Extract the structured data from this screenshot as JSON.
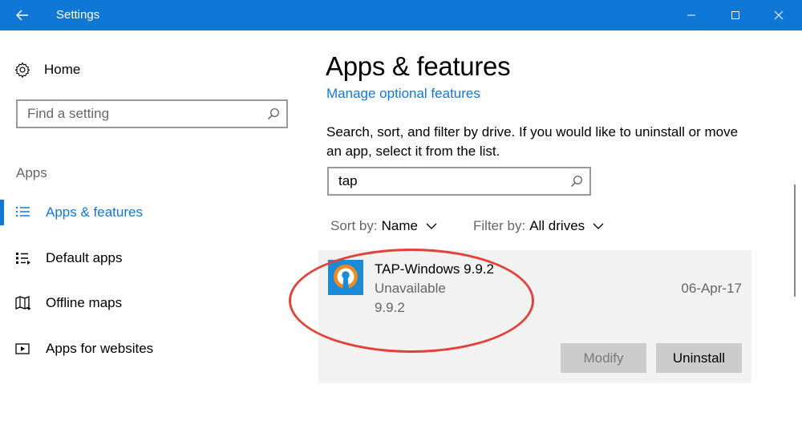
{
  "window": {
    "title": "Settings",
    "accent": "#0f78d7"
  },
  "sidebar": {
    "home_label": "Home",
    "search_placeholder": "Find a setting",
    "section_label": "Apps",
    "items": [
      {
        "label": "Apps & features",
        "icon": "list-icon",
        "active": true
      },
      {
        "label": "Default apps",
        "icon": "default-apps-icon",
        "active": false
      },
      {
        "label": "Offline maps",
        "icon": "map-icon",
        "active": false
      },
      {
        "label": "Apps for websites",
        "icon": "website-icon",
        "active": false
      }
    ]
  },
  "main": {
    "title": "Apps & features",
    "manage_link": "Manage optional features",
    "description": "Search, sort, and filter by drive. If you would like to uninstall or move an app, select it from the list.",
    "search_value": "tap",
    "sort_label": "Sort by:",
    "sort_value": "Name",
    "filter_label": "Filter by:",
    "filter_value": "All drives",
    "app": {
      "name": "TAP-Windows 9.9.2",
      "status": "Unavailable",
      "version": "9.9.2",
      "date": "06-Apr-17",
      "modify_label": "Modify",
      "uninstall_label": "Uninstall"
    }
  }
}
